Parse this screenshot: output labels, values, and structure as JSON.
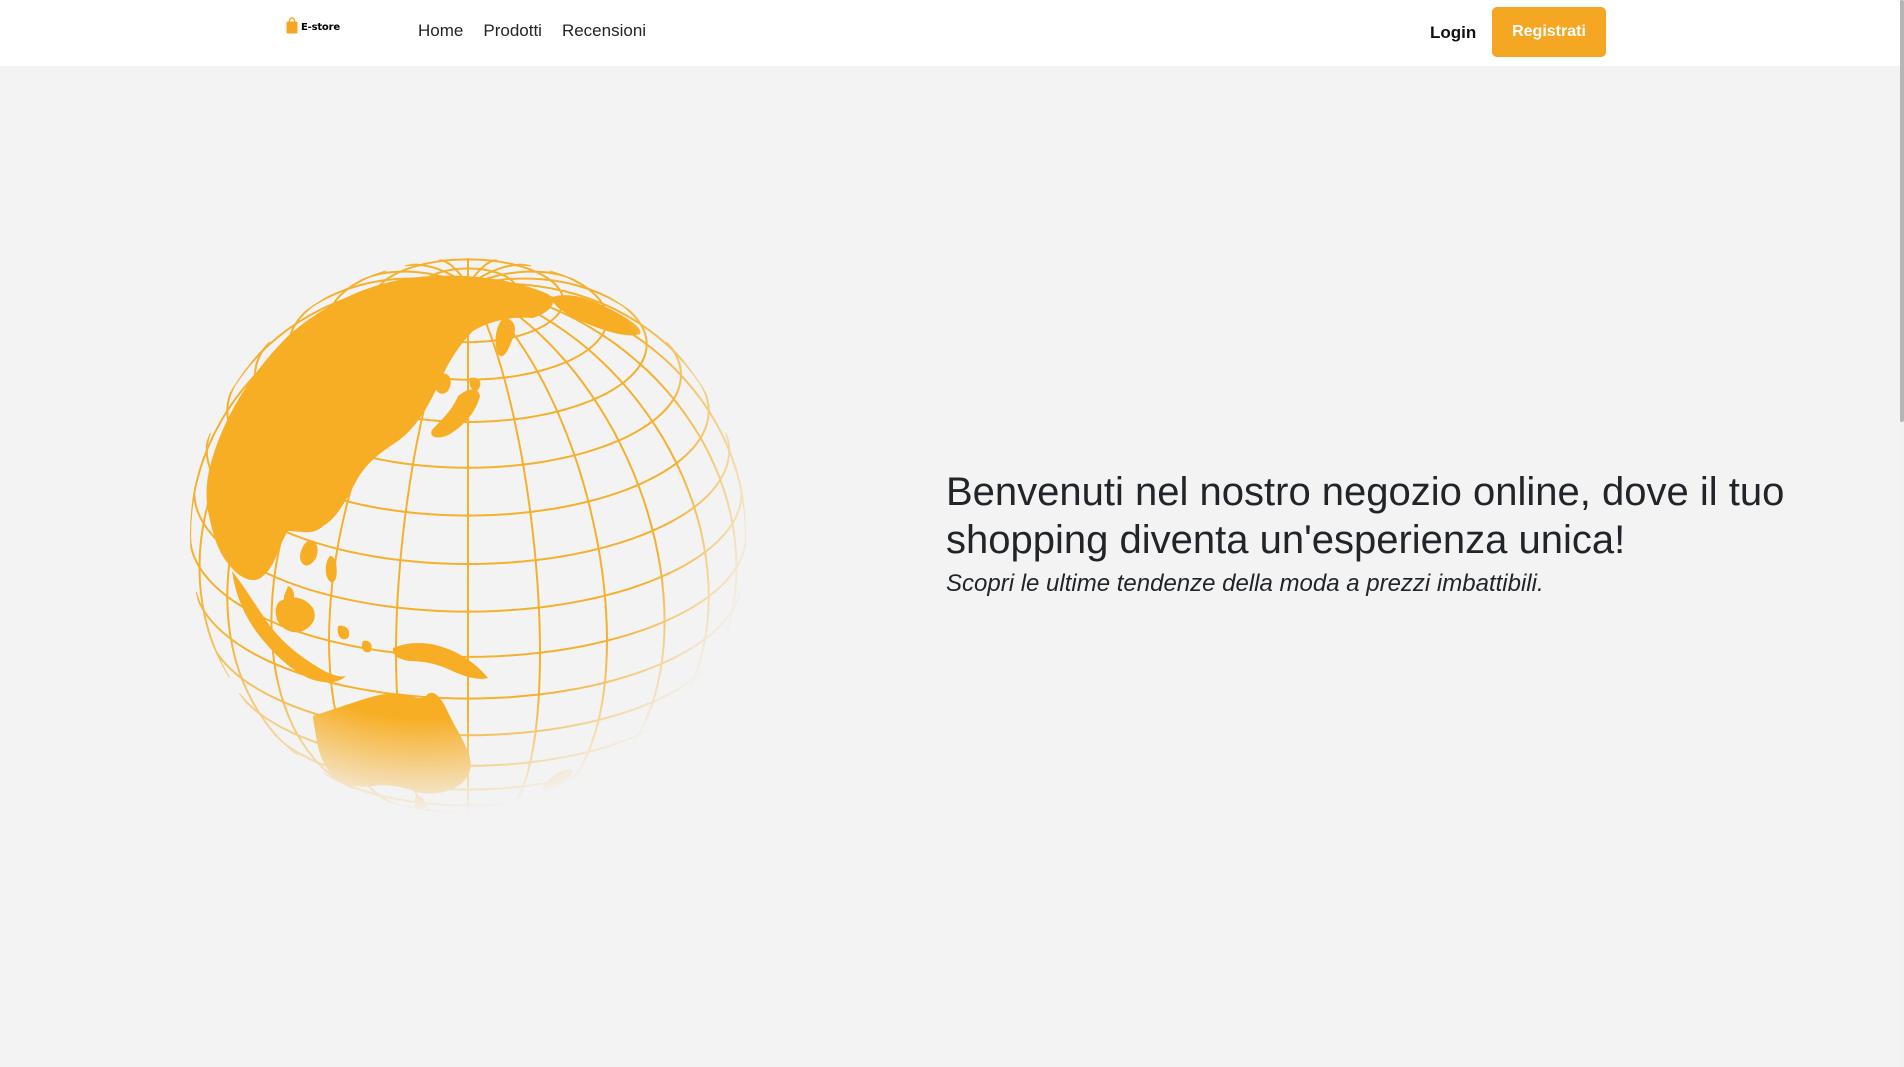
{
  "nav": {
    "brand": "E-store",
    "links": [
      "Home",
      "Prodotti",
      "Recensioni"
    ],
    "login": "Login",
    "register": "Registrati"
  },
  "hero": {
    "title_line1": "Benvenuti nel nostro negozio online, dove il tuo",
    "title_line2": "shopping diventa un'esperienza unica!",
    "subtitle": "Scopri le ultime tendenze della moda a prezzi imbattibili."
  },
  "colors": {
    "accent": "#f5a623",
    "background": "#f3f3f3",
    "navbar": "#ffffff",
    "text": "#212529"
  },
  "icons": {
    "brand": "shopping-bag-icon",
    "illustration": "globe-icon"
  }
}
